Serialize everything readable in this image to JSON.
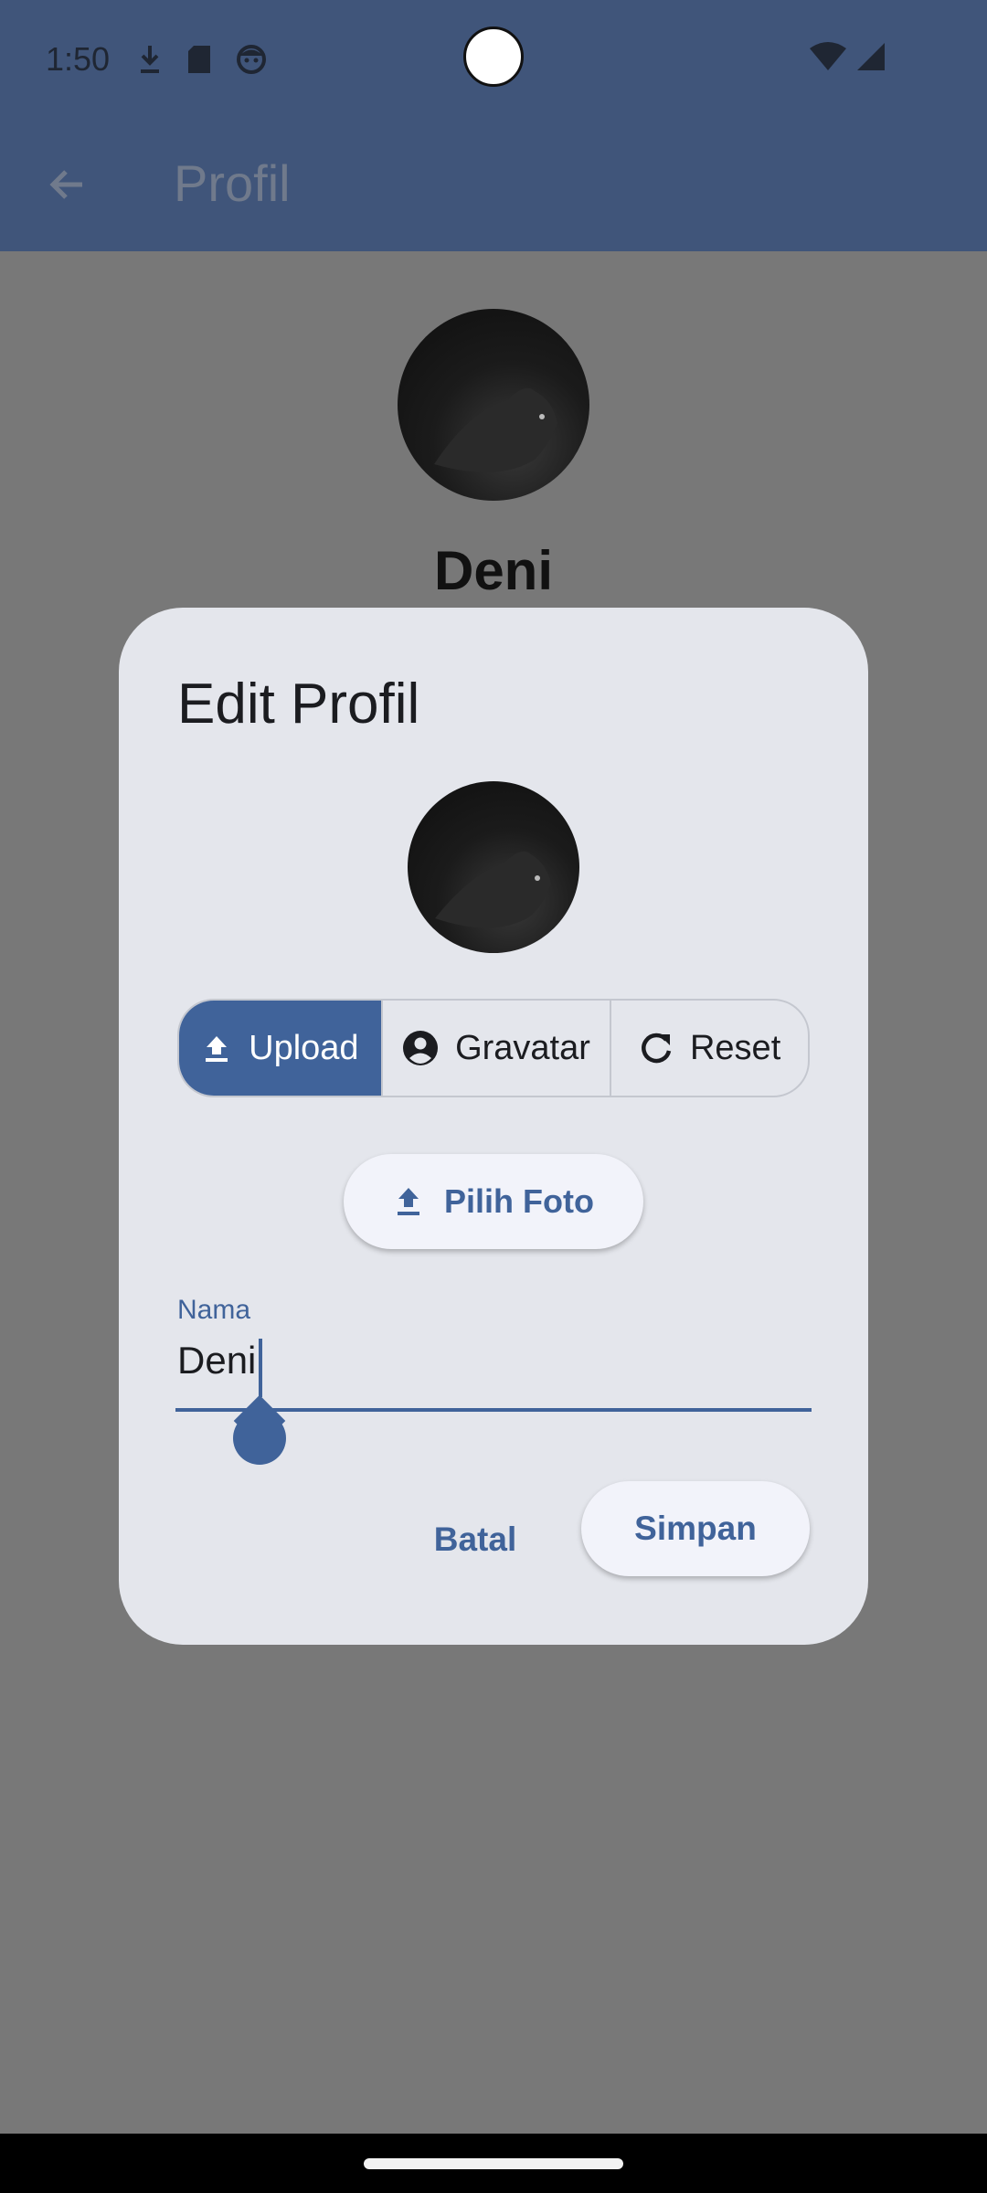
{
  "status_bar": {
    "time": "1:50"
  },
  "app_bar": {
    "title": "Profil"
  },
  "page": {
    "user_name": "Deni"
  },
  "dialog": {
    "title": "Edit Profil",
    "segments": [
      {
        "label": "Upload",
        "icon": "upload-icon",
        "selected": true
      },
      {
        "label": "Gravatar",
        "icon": "account-circle-icon",
        "selected": false
      },
      {
        "label": "Reset",
        "icon": "refresh-icon",
        "selected": false
      }
    ],
    "pick_photo_label": "Pilih Foto",
    "name_field": {
      "label": "Nama",
      "value": "Deni"
    },
    "cancel_label": "Batal",
    "save_label": "Simpan"
  },
  "colors": {
    "primary": "#40639A",
    "app_bar": "#40557A",
    "scrim_background": "#787878",
    "dialog_surface": "#E4E6EC"
  }
}
